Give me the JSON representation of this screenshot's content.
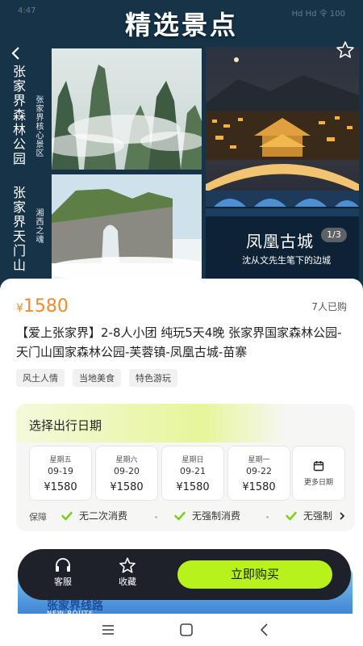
{
  "status_bar": {
    "time": "4:47",
    "indicators": "Hd Hd 令 100"
  },
  "hero": {
    "title": "精选景点",
    "spots": [
      {
        "name": "张家界森林公园",
        "subtitle": "张家界核心景区"
      },
      {
        "name": "张家界天门山",
        "subtitle": "湘西之魂"
      },
      {
        "name": "凤凰古城",
        "subtitle": "沈从文先生笔下的边城",
        "pager": "1/3"
      }
    ]
  },
  "product": {
    "currency": "¥",
    "price": "1580",
    "sold": "7人已购",
    "title": "【爱上张家界】2-8人小团 纯玩5天4晚 张家界国家森林公园-天门山国家森林公园-芙蓉镇-凤凰古城-苗寨",
    "tags": [
      "风土人情",
      "当地美食",
      "特色游玩"
    ]
  },
  "date_selector": {
    "heading": "选择出行日期",
    "dates": [
      {
        "weekday": "星期五",
        "date": "09-19",
        "price": "¥1580"
      },
      {
        "weekday": "星期六",
        "date": "09-20",
        "price": "¥1580"
      },
      {
        "weekday": "星期日",
        "date": "09-21",
        "price": "¥1580"
      },
      {
        "weekday": "星期一",
        "date": "09-22",
        "price": "¥1580"
      }
    ],
    "more_label": "更多日期"
  },
  "guarantee": {
    "label": "保障",
    "items": [
      "无二次消费",
      "无强制消费",
      "无强制"
    ]
  },
  "banner": {
    "title": "张家界线路",
    "subtitle": "NEW ROUTE"
  },
  "bottom_bar": {
    "service_label": "客服",
    "favorite_label": "收藏",
    "buy_label": "立即购买"
  },
  "colors": {
    "accent": "#b7f21c",
    "price": "#f08a2d",
    "dark": "#1e2129",
    "hero_bg": "#163348"
  }
}
